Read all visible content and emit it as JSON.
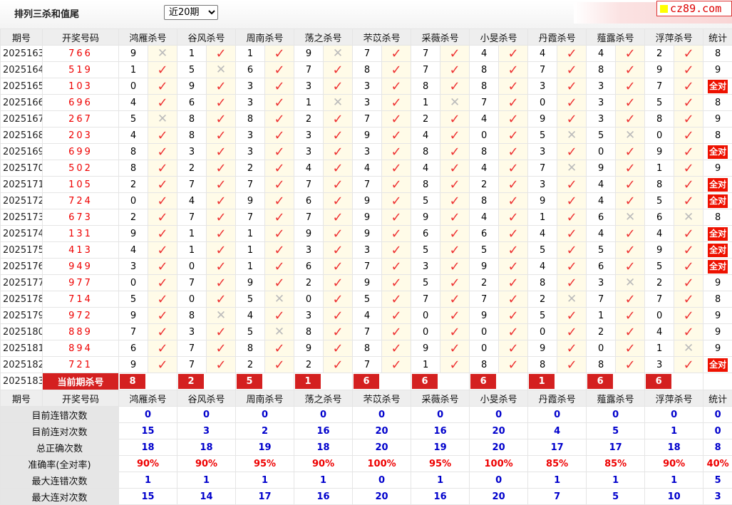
{
  "header": {
    "title": "排列三杀和值尾",
    "period_selected": "近20期",
    "logo_text": "cz89.com"
  },
  "columns": [
    "期号",
    "开奖号码",
    "鸿雁杀号",
    "谷风杀号",
    "周南杀号",
    "荡之杀号",
    "芣苡杀号",
    "采薇杀号",
    "小旻杀号",
    "丹霞杀号",
    "薤露杀号",
    "浮萍杀号",
    "统计"
  ],
  "rows": [
    {
      "period": "2025163",
      "draw": "766",
      "kills": [
        [
          9,
          0
        ],
        [
          1,
          1
        ],
        [
          1,
          1
        ],
        [
          9,
          0
        ],
        [
          7,
          1
        ],
        [
          7,
          1
        ],
        [
          4,
          1
        ],
        [
          4,
          1
        ],
        [
          4,
          1
        ],
        [
          2,
          1
        ]
      ],
      "stat": "8"
    },
    {
      "period": "2025164",
      "draw": "519",
      "kills": [
        [
          1,
          1
        ],
        [
          5,
          0
        ],
        [
          6,
          1
        ],
        [
          7,
          1
        ],
        [
          8,
          1
        ],
        [
          7,
          1
        ],
        [
          8,
          1
        ],
        [
          7,
          1
        ],
        [
          8,
          1
        ],
        [
          9,
          1
        ]
      ],
      "stat": "9"
    },
    {
      "period": "2025165",
      "draw": "103",
      "kills": [
        [
          0,
          1
        ],
        [
          9,
          1
        ],
        [
          3,
          1
        ],
        [
          3,
          1
        ],
        [
          3,
          1
        ],
        [
          8,
          1
        ],
        [
          8,
          1
        ],
        [
          3,
          1
        ],
        [
          3,
          1
        ],
        [
          7,
          1
        ]
      ],
      "stat": "全对"
    },
    {
      "period": "2025166",
      "draw": "696",
      "kills": [
        [
          4,
          1
        ],
        [
          6,
          1
        ],
        [
          3,
          1
        ],
        [
          1,
          0
        ],
        [
          3,
          1
        ],
        [
          1,
          0
        ],
        [
          7,
          1
        ],
        [
          0,
          1
        ],
        [
          3,
          1
        ],
        [
          5,
          1
        ]
      ],
      "stat": "8"
    },
    {
      "period": "2025167",
      "draw": "267",
      "kills": [
        [
          5,
          0
        ],
        [
          8,
          1
        ],
        [
          8,
          1
        ],
        [
          2,
          1
        ],
        [
          7,
          1
        ],
        [
          2,
          1
        ],
        [
          4,
          1
        ],
        [
          9,
          1
        ],
        [
          3,
          1
        ],
        [
          8,
          1
        ]
      ],
      "stat": "9"
    },
    {
      "period": "2025168",
      "draw": "203",
      "kills": [
        [
          4,
          1
        ],
        [
          8,
          1
        ],
        [
          3,
          1
        ],
        [
          3,
          1
        ],
        [
          9,
          1
        ],
        [
          4,
          1
        ],
        [
          0,
          1
        ],
        [
          5,
          0
        ],
        [
          5,
          0
        ],
        [
          0,
          1
        ]
      ],
      "stat": "8"
    },
    {
      "period": "2025169",
      "draw": "699",
      "kills": [
        [
          8,
          1
        ],
        [
          3,
          1
        ],
        [
          3,
          1
        ],
        [
          3,
          1
        ],
        [
          3,
          1
        ],
        [
          8,
          1
        ],
        [
          8,
          1
        ],
        [
          3,
          1
        ],
        [
          0,
          1
        ],
        [
          9,
          1
        ]
      ],
      "stat": "全对"
    },
    {
      "period": "2025170",
      "draw": "502",
      "kills": [
        [
          8,
          1
        ],
        [
          2,
          1
        ],
        [
          2,
          1
        ],
        [
          4,
          1
        ],
        [
          4,
          1
        ],
        [
          4,
          1
        ],
        [
          4,
          1
        ],
        [
          7,
          0
        ],
        [
          9,
          1
        ],
        [
          1,
          1
        ]
      ],
      "stat": "9"
    },
    {
      "period": "2025171",
      "draw": "105",
      "kills": [
        [
          2,
          1
        ],
        [
          7,
          1
        ],
        [
          7,
          1
        ],
        [
          7,
          1
        ],
        [
          7,
          1
        ],
        [
          8,
          1
        ],
        [
          2,
          1
        ],
        [
          3,
          1
        ],
        [
          4,
          1
        ],
        [
          8,
          1
        ]
      ],
      "stat": "全对"
    },
    {
      "period": "2025172",
      "draw": "724",
      "kills": [
        [
          0,
          1
        ],
        [
          4,
          1
        ],
        [
          9,
          1
        ],
        [
          6,
          1
        ],
        [
          9,
          1
        ],
        [
          5,
          1
        ],
        [
          8,
          1
        ],
        [
          9,
          1
        ],
        [
          4,
          1
        ],
        [
          5,
          1
        ]
      ],
      "stat": "全对"
    },
    {
      "period": "2025173",
      "draw": "673",
      "kills": [
        [
          2,
          1
        ],
        [
          7,
          1
        ],
        [
          7,
          1
        ],
        [
          7,
          1
        ],
        [
          9,
          1
        ],
        [
          9,
          1
        ],
        [
          4,
          1
        ],
        [
          1,
          1
        ],
        [
          6,
          0
        ],
        [
          6,
          0
        ]
      ],
      "stat": "8"
    },
    {
      "period": "2025174",
      "draw": "131",
      "kills": [
        [
          9,
          1
        ],
        [
          1,
          1
        ],
        [
          1,
          1
        ],
        [
          9,
          1
        ],
        [
          9,
          1
        ],
        [
          6,
          1
        ],
        [
          6,
          1
        ],
        [
          4,
          1
        ],
        [
          4,
          1
        ],
        [
          4,
          1
        ]
      ],
      "stat": "全对"
    },
    {
      "period": "2025175",
      "draw": "413",
      "kills": [
        [
          4,
          1
        ],
        [
          1,
          1
        ],
        [
          1,
          1
        ],
        [
          3,
          1
        ],
        [
          3,
          1
        ],
        [
          5,
          1
        ],
        [
          5,
          1
        ],
        [
          5,
          1
        ],
        [
          5,
          1
        ],
        [
          9,
          1
        ]
      ],
      "stat": "全对"
    },
    {
      "period": "2025176",
      "draw": "949",
      "kills": [
        [
          3,
          1
        ],
        [
          0,
          1
        ],
        [
          1,
          1
        ],
        [
          6,
          1
        ],
        [
          7,
          1
        ],
        [
          3,
          1
        ],
        [
          9,
          1
        ],
        [
          4,
          1
        ],
        [
          6,
          1
        ],
        [
          5,
          1
        ]
      ],
      "stat": "全对"
    },
    {
      "period": "2025177",
      "draw": "977",
      "kills": [
        [
          0,
          1
        ],
        [
          7,
          1
        ],
        [
          9,
          1
        ],
        [
          2,
          1
        ],
        [
          9,
          1
        ],
        [
          5,
          1
        ],
        [
          2,
          1
        ],
        [
          8,
          1
        ],
        [
          3,
          0
        ],
        [
          2,
          1
        ]
      ],
      "stat": "9"
    },
    {
      "period": "2025178",
      "draw": "714",
      "kills": [
        [
          5,
          1
        ],
        [
          0,
          1
        ],
        [
          5,
          0
        ],
        [
          0,
          1
        ],
        [
          5,
          1
        ],
        [
          7,
          1
        ],
        [
          7,
          1
        ],
        [
          2,
          0
        ],
        [
          7,
          1
        ],
        [
          7,
          1
        ]
      ],
      "stat": "8"
    },
    {
      "period": "2025179",
      "draw": "972",
      "kills": [
        [
          9,
          1
        ],
        [
          8,
          0
        ],
        [
          4,
          1
        ],
        [
          3,
          1
        ],
        [
          4,
          1
        ],
        [
          0,
          1
        ],
        [
          9,
          1
        ],
        [
          5,
          1
        ],
        [
          1,
          1
        ],
        [
          0,
          1
        ]
      ],
      "stat": "9"
    },
    {
      "period": "2025180",
      "draw": "889",
      "kills": [
        [
          7,
          1
        ],
        [
          3,
          1
        ],
        [
          5,
          0
        ],
        [
          8,
          1
        ],
        [
          7,
          1
        ],
        [
          0,
          1
        ],
        [
          0,
          1
        ],
        [
          0,
          1
        ],
        [
          2,
          1
        ],
        [
          4,
          1
        ]
      ],
      "stat": "9"
    },
    {
      "period": "2025181",
      "draw": "894",
      "kills": [
        [
          6,
          1
        ],
        [
          7,
          1
        ],
        [
          8,
          1
        ],
        [
          9,
          1
        ],
        [
          8,
          1
        ],
        [
          9,
          1
        ],
        [
          0,
          1
        ],
        [
          9,
          1
        ],
        [
          0,
          1
        ],
        [
          1,
          0
        ]
      ],
      "stat": "9"
    },
    {
      "period": "2025182",
      "draw": "721",
      "kills": [
        [
          9,
          1
        ],
        [
          7,
          1
        ],
        [
          2,
          1
        ],
        [
          2,
          1
        ],
        [
          7,
          1
        ],
        [
          1,
          1
        ],
        [
          8,
          1
        ],
        [
          8,
          1
        ],
        [
          8,
          1
        ],
        [
          3,
          1
        ]
      ],
      "stat": "全对"
    }
  ],
  "current": {
    "period": "2025183",
    "label": "当前期杀号",
    "kills": [
      "8",
      "2",
      "5",
      "1",
      "6",
      "6",
      "6",
      "1",
      "6",
      "6"
    ]
  },
  "stats": [
    {
      "label": "目前连错次数",
      "values": [
        "0",
        "0",
        "0",
        "0",
        "0",
        "0",
        "0",
        "0",
        "0",
        "0",
        "0"
      ],
      "cls": "sv"
    },
    {
      "label": "目前连对次数",
      "values": [
        "15",
        "3",
        "2",
        "16",
        "20",
        "16",
        "20",
        "4",
        "5",
        "1",
        "0"
      ],
      "cls": "sv"
    },
    {
      "label": "总正确次数",
      "values": [
        "18",
        "18",
        "19",
        "18",
        "20",
        "19",
        "20",
        "17",
        "17",
        "18",
        "8"
      ],
      "cls": "sv"
    },
    {
      "label": "准确率(全对率)",
      "values": [
        "90%",
        "90%",
        "95%",
        "90%",
        "100%",
        "95%",
        "100%",
        "85%",
        "85%",
        "90%",
        "40%"
      ],
      "cls": "sr"
    },
    {
      "label": "最大连错次数",
      "values": [
        "1",
        "1",
        "1",
        "1",
        "0",
        "1",
        "0",
        "1",
        "1",
        "1",
        "5"
      ],
      "cls": "sv"
    },
    {
      "label": "最大连对次数",
      "values": [
        "15",
        "14",
        "17",
        "16",
        "20",
        "16",
        "20",
        "7",
        "5",
        "10",
        "3"
      ],
      "cls": "sv"
    }
  ],
  "icons": {
    "correct": "check-icon",
    "wrong": "cross-icon"
  },
  "colors": {
    "accent": "#e00000",
    "stat_value": "#0000cc",
    "correct_mark": "#ee3333",
    "wrong_mark": "#bbbbbb",
    "current_bg": "#d42020"
  }
}
